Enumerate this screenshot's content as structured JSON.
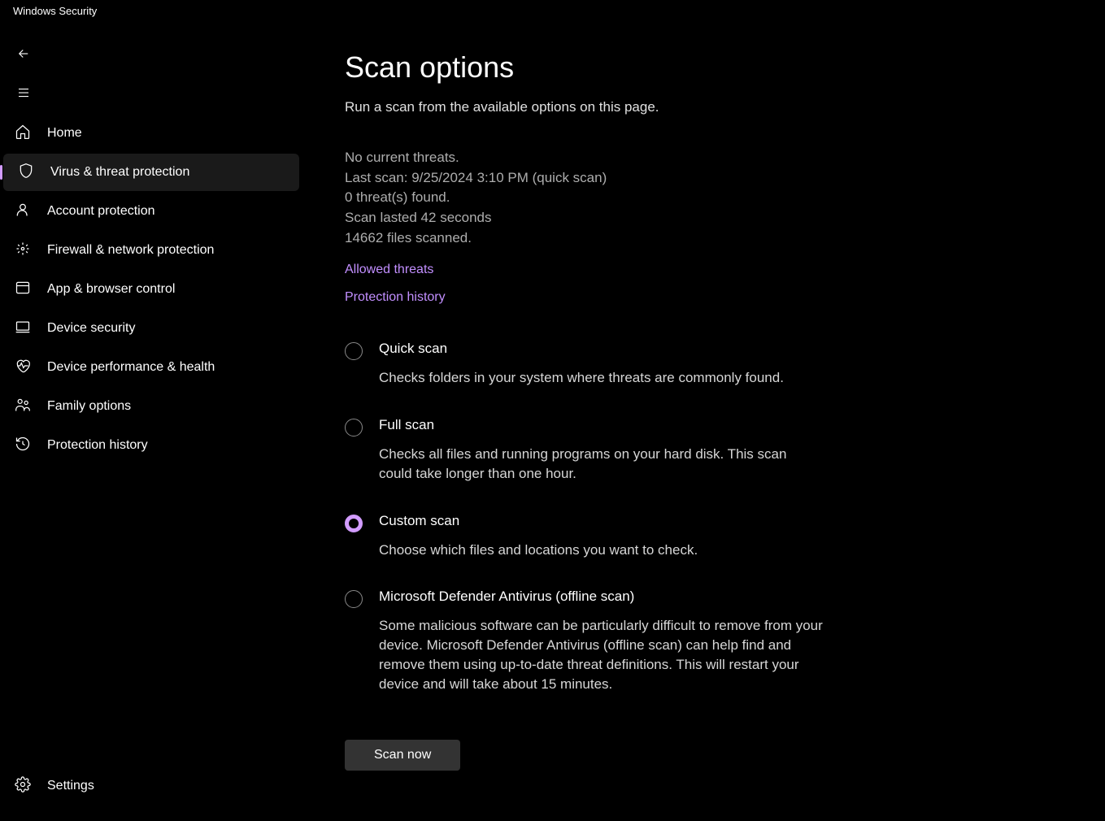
{
  "window_title": "Windows Security",
  "sidebar": {
    "items": [
      {
        "label": "Home"
      },
      {
        "label": "Virus & threat protection"
      },
      {
        "label": "Account protection"
      },
      {
        "label": "Firewall & network protection"
      },
      {
        "label": "App & browser control"
      },
      {
        "label": "Device security"
      },
      {
        "label": "Device performance & health"
      },
      {
        "label": "Family options"
      },
      {
        "label": "Protection history"
      }
    ],
    "settings_label": "Settings"
  },
  "main": {
    "title": "Scan options",
    "subtitle": "Run a scan from the available options on this page.",
    "status": {
      "line1": "No current threats.",
      "line2": "Last scan: 9/25/2024 3:10 PM (quick scan)",
      "line3": "0 threat(s) found.",
      "line4": "Scan lasted 42 seconds",
      "line5": "14662 files scanned."
    },
    "links": {
      "allowed": "Allowed threats",
      "history": "Protection history"
    },
    "options": [
      {
        "title": "Quick scan",
        "desc": "Checks folders in your system where threats are commonly found.",
        "selected": false
      },
      {
        "title": "Full scan",
        "desc": "Checks all files and running programs on your hard disk. This scan could take longer than one hour.",
        "selected": false
      },
      {
        "title": "Custom scan",
        "desc": "Choose which files and locations you want to check.",
        "selected": true
      },
      {
        "title": "Microsoft Defender Antivirus (offline scan)",
        "desc": "Some malicious software can be particularly difficult to remove from your device. Microsoft Defender Antivirus (offline scan) can help find and remove them using up-to-date threat definitions. This will restart your device and will take about 15 minutes.",
        "selected": false
      }
    ],
    "scan_button": "Scan now"
  }
}
